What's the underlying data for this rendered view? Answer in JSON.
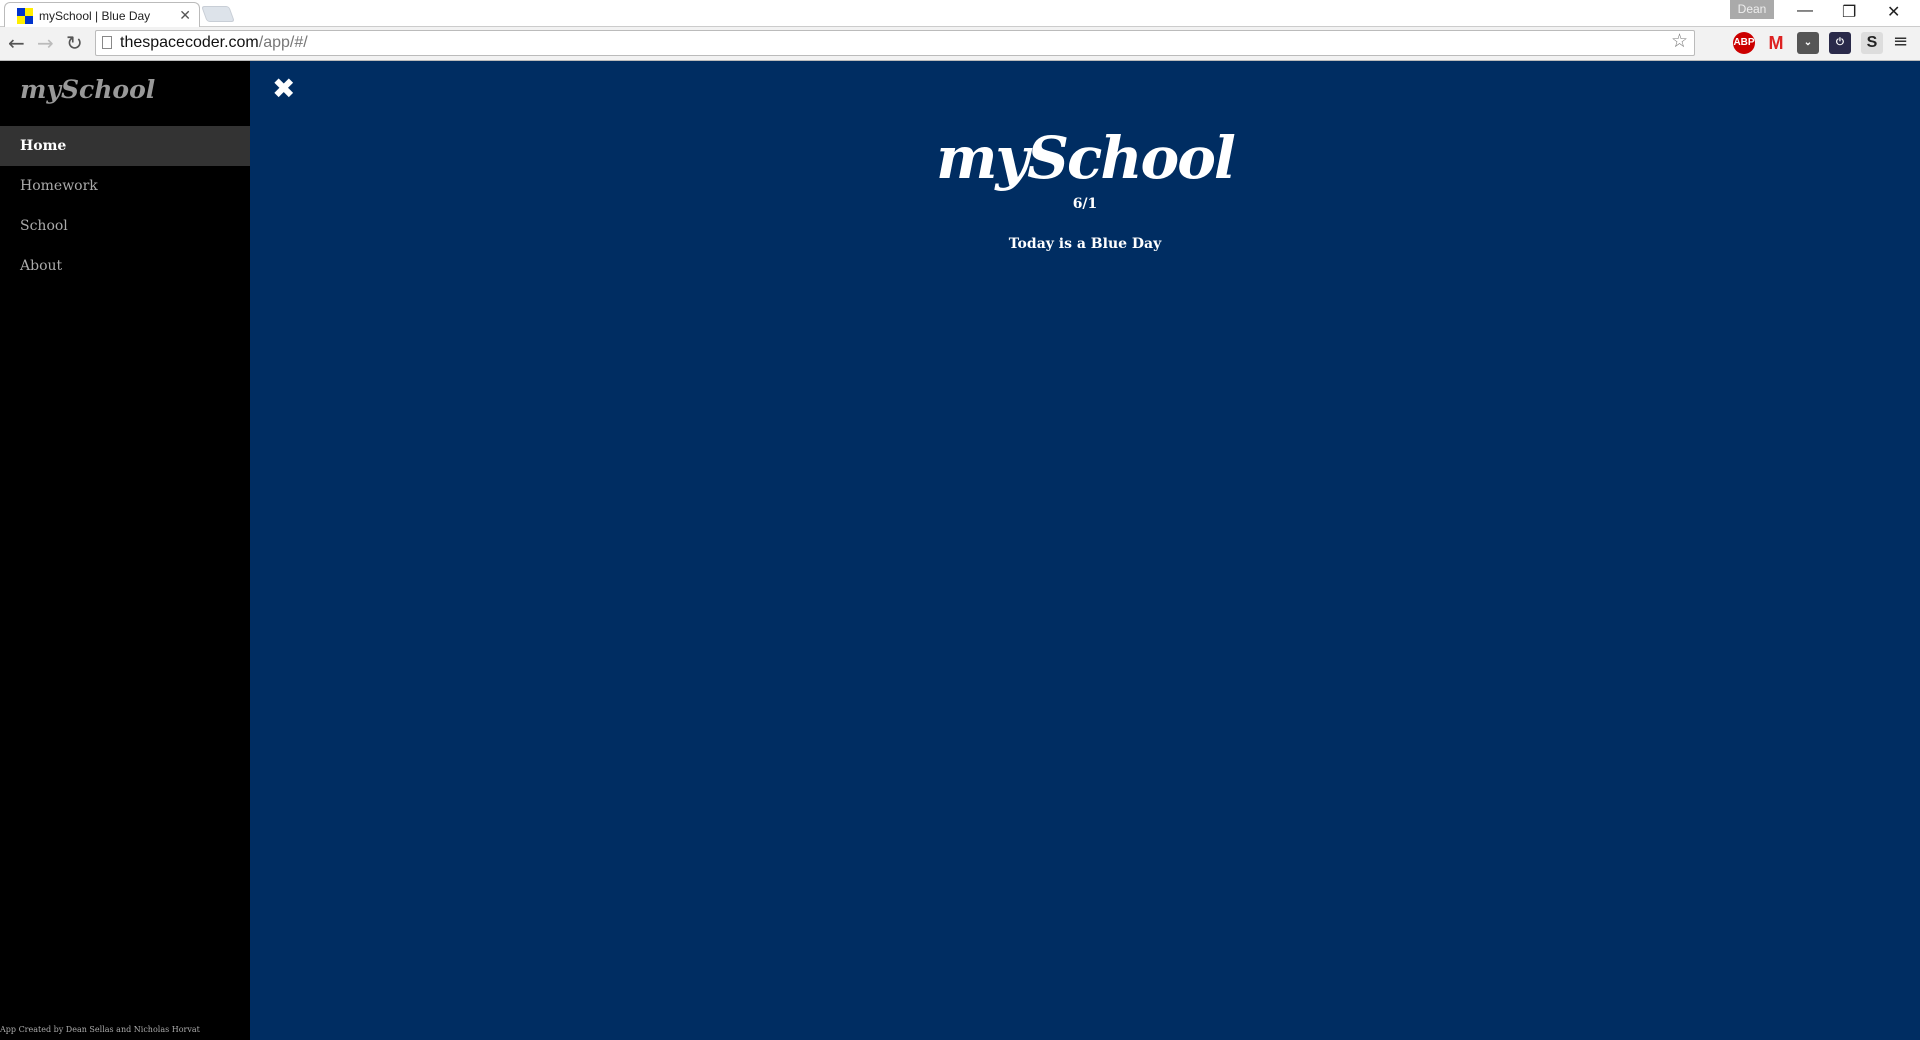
{
  "browser": {
    "tab_title": "mySchool | Blue Day",
    "url_host": "thespacecoder.com",
    "url_path": "/app/#/",
    "user": "Dean",
    "extensions": [
      {
        "name": "ABP",
        "badge": "1",
        "color": "#c00"
      },
      {
        "name": "M",
        "badge": "2",
        "color": "#d22"
      },
      {
        "name": "pocket",
        "color": "#555"
      },
      {
        "name": "power",
        "color": "#2a2a4a"
      },
      {
        "name": "S",
        "color": "#ddd"
      }
    ]
  },
  "sidebar": {
    "logo": "mySchool",
    "items": [
      {
        "label": "Home"
      },
      {
        "label": "Homework"
      },
      {
        "label": "School"
      },
      {
        "label": "About"
      }
    ],
    "credit": "App Created by Dean Sellas and Nicholas Horvat"
  },
  "main": {
    "title": "mySchool",
    "date": "6/1",
    "message": "Today is a Blue Day"
  },
  "colors": {
    "main_bg": "#002d62",
    "sidebar_bg": "#000000",
    "active_item": "#333333"
  }
}
